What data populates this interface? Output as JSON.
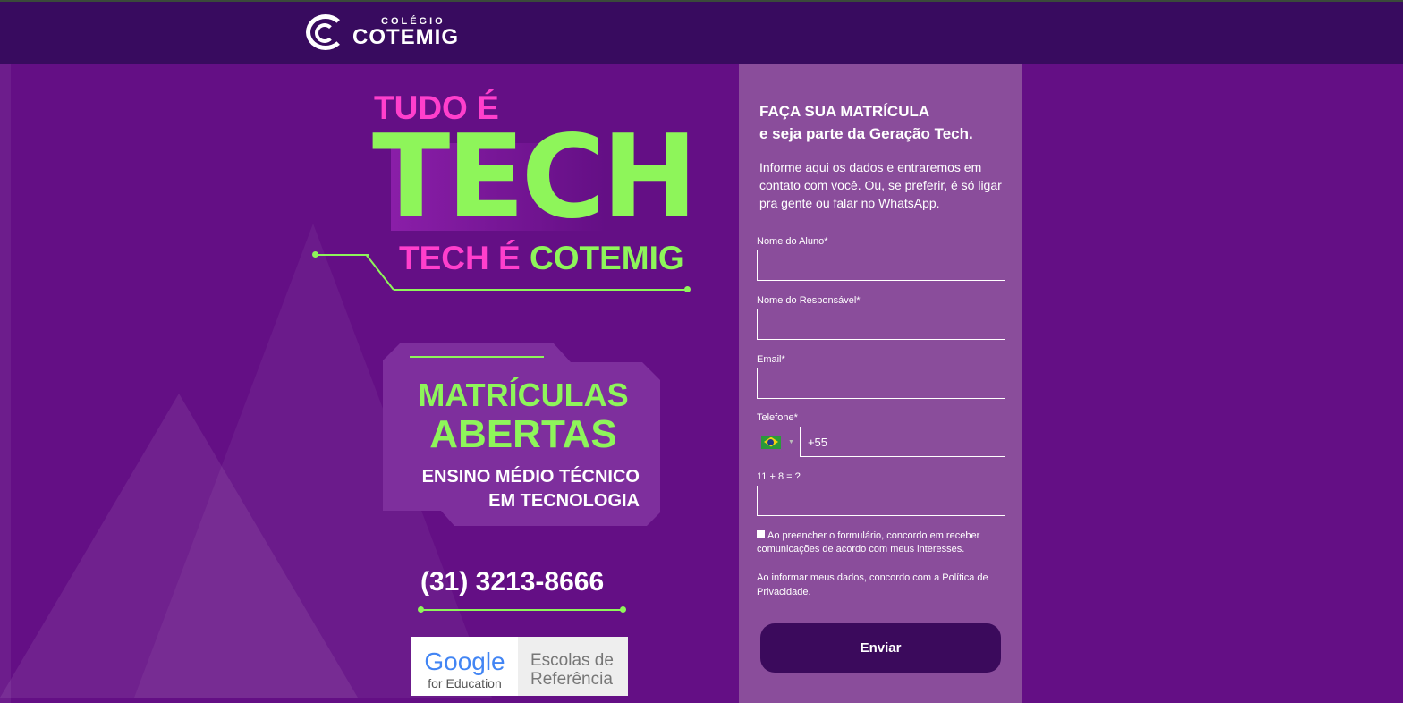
{
  "header": {
    "logo_sub": "COLÉGIO",
    "logo_main": "COTEMIG"
  },
  "hero": {
    "line1": "TUDO É",
    "line2": "TECH",
    "line3a": "TECH É",
    "line3b": "COTEMIG"
  },
  "badge": {
    "title1": "MATRÍCULAS",
    "title2": "ABERTAS",
    "sub1": "ENSINO MÉDIO TÉCNICO",
    "sub2": "EM TECNOLOGIA"
  },
  "phone": "(31) 3213-8666",
  "partner": {
    "google": "Google",
    "for": "for Education",
    "escolas1": "Escolas de",
    "escolas2": "Referência"
  },
  "form": {
    "title1": "FAÇA SUA MATRÍCULA",
    "title2": "e seja parte da Geração Tech.",
    "intro": "Informe aqui os dados e entraremos em contato com você. Ou, se preferir, é só ligar pra gente ou falar no WhatsApp.",
    "fields": [
      {
        "label": "Nome do Aluno*"
      },
      {
        "label": "Nome do Responsável*"
      },
      {
        "label": "Email*"
      }
    ],
    "phone_label": "Telefone*",
    "phone_value": "+55",
    "captcha_label": "11 + 8 = ?",
    "consent": "Ao preencher o formulário, concordo em receber comunicações de acordo com meus interesses.",
    "privacy": "Ao informar meus dados, concordo com a Política de Privacidade.",
    "submit": "Enviar"
  },
  "colors": {
    "pink": "#ff3fcc",
    "green": "#8ef55a",
    "header": "#380b5f",
    "panel": "#8a4d9b"
  }
}
